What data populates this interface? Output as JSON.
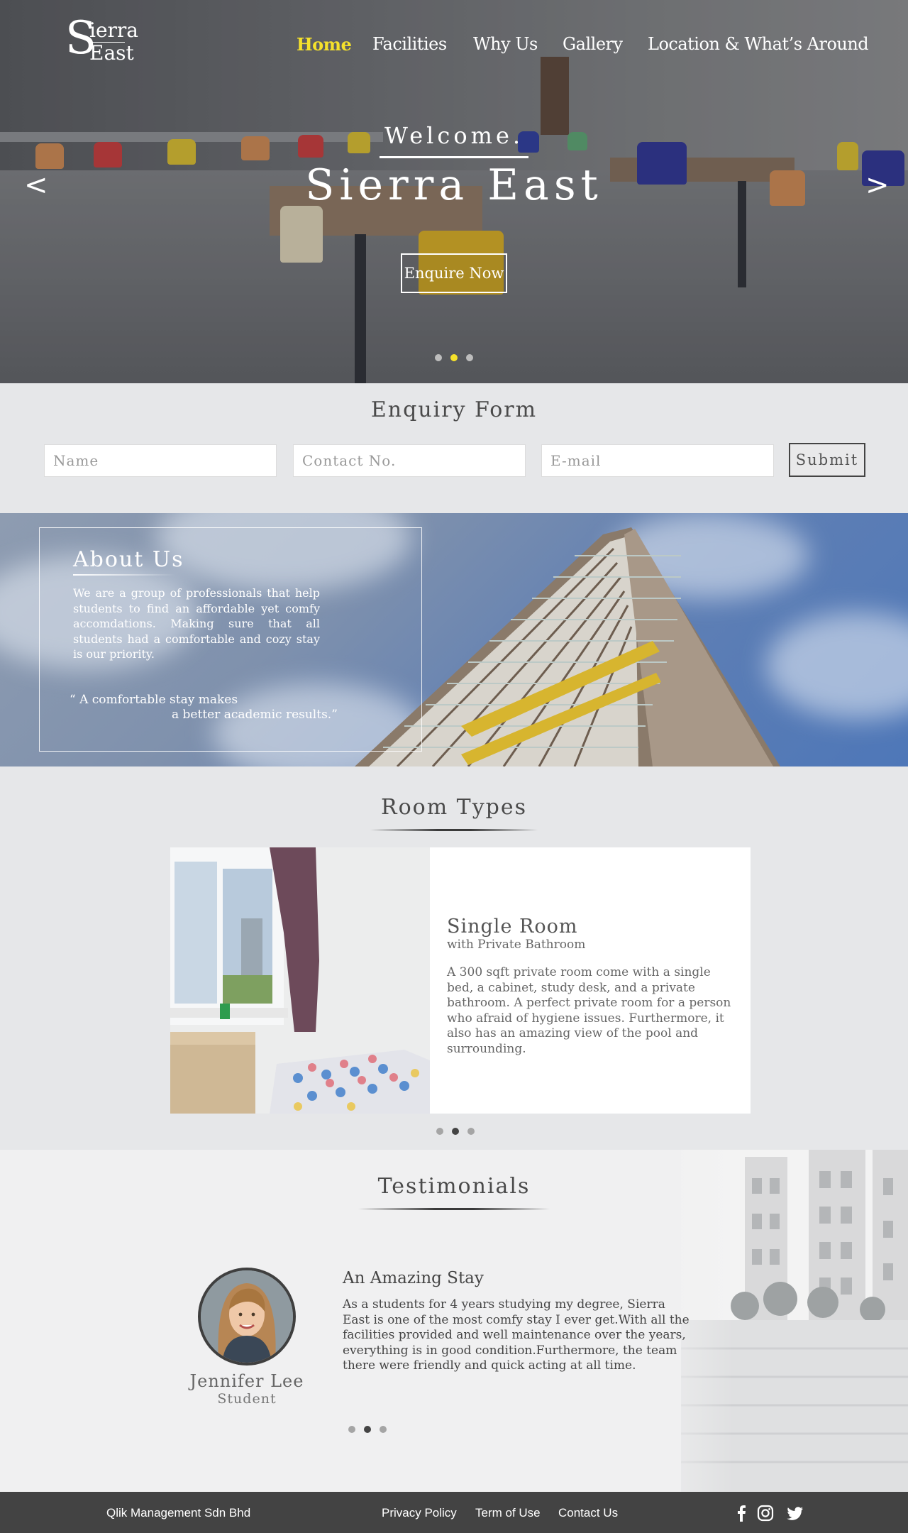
{
  "brand": {
    "logo_initial": "S",
    "logo_line1": "ierra",
    "logo_line2": "East",
    "logo_initial2": "E"
  },
  "nav": {
    "items": [
      {
        "label": "Home",
        "active": true
      },
      {
        "label": "Facilities",
        "active": false
      },
      {
        "label": "Why Us",
        "active": false
      },
      {
        "label": "Gallery",
        "active": false
      },
      {
        "label": "Location & What’s Around",
        "active": false
      }
    ]
  },
  "hero": {
    "welcome": "Welcome.",
    "title": "Sierra East",
    "cta": "Enquire Now",
    "prev_arrow": "<",
    "next_arrow": ">",
    "slides": 3,
    "active_slide": 2
  },
  "enquiry": {
    "title": "Enquiry Form",
    "name_placeholder": "Name",
    "contact_placeholder": "Contact No.",
    "email_placeholder": "E-mail",
    "submit": "Submit"
  },
  "about": {
    "title": "About Us",
    "text": "We are a group of professionals that help students to find an affordable yet comfy accomdations. Making sure that all students had a comfortable and cozy stay is our priority.",
    "quote_line1": "“ A comfortable stay makes",
    "quote_line2": "a better academic results.”"
  },
  "rooms": {
    "title": "Room Types",
    "name": "Single Room",
    "subtitle": "with Private Bathroom",
    "description": "A 300 sqft private room come with a single bed, a cabinet, study desk, and a private bathroom. A perfect private room for a person who afraid of hygiene issues. Furthermore, it also has an amazing view of the pool and surrounding.",
    "slides": 3,
    "active_slide": 2
  },
  "testimonials": {
    "title": "Testimonials",
    "heading": "An Amazing Stay",
    "body": "As a students for 4 years studying my degree, Sierra East is one of the most comfy stay I ever get.With all the facilities provided and well maintenance over the years, everything is in good condition.Furthermore, the team there were friendly and quick acting at all time.",
    "person": "Jennifer Lee",
    "role": "Student",
    "slides": 3,
    "active_slide": 2
  },
  "footer": {
    "company": "Qlik Management Sdn Bhd",
    "links": [
      "Privacy Policy",
      "Term of Use",
      "Contact Us"
    ],
    "social": [
      "facebook-icon",
      "instagram-icon",
      "twitter-icon"
    ]
  },
  "colors": {
    "accent": "#f5e12b",
    "footer_bg": "#434343",
    "page_bg": "#e6e7e9"
  }
}
